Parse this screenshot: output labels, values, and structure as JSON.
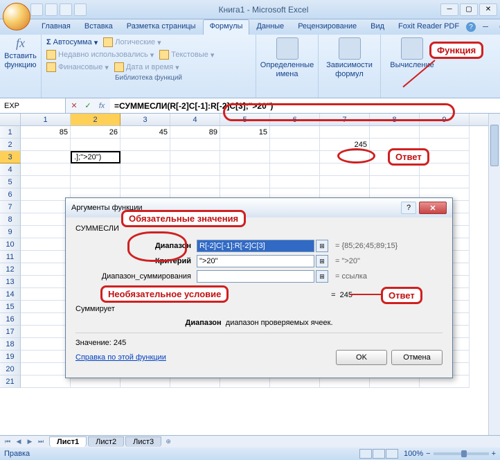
{
  "window": {
    "title": "Книга1 - Microsoft Excel"
  },
  "ribbon": {
    "tabs": [
      "Главная",
      "Вставка",
      "Разметка страницы",
      "Формулы",
      "Данные",
      "Рецензирование",
      "Вид",
      "Foxit Reader PDF"
    ],
    "active_tab": "Формулы",
    "help_icon": "?",
    "insert_fn": {
      "label": "Вставить\nфункцию"
    },
    "library": {
      "autosum": "Автосумма",
      "recent": "Недавно использовались",
      "financial": "Финансовые",
      "logical": "Логические",
      "text": "Текстовые",
      "datetime": "Дата и время",
      "group_label": "Библиотека функций"
    },
    "names": {
      "label": "Определенные\nимена"
    },
    "deps": {
      "label": "Зависимости\nформул"
    },
    "calc": {
      "label": "Вычисление"
    }
  },
  "formula_bar": {
    "name_box": "EXP",
    "formula": "=СУММЕСЛИ(R[-2]C[-1]:R[-2]C[3];\">20\")"
  },
  "columns": [
    "1",
    "2",
    "3",
    "4",
    "5",
    "6",
    "7",
    "8",
    "9"
  ],
  "rows": [
    {
      "n": "1",
      "cells": [
        "85",
        "26",
        "45",
        "89",
        "15",
        "",
        "",
        "",
        ""
      ]
    },
    {
      "n": "2",
      "cells": [
        "",
        "",
        "",
        "",
        "",
        "",
        "245",
        "",
        ""
      ]
    },
    {
      "n": "3",
      "cells": [
        "",
        ".];\">20\")",
        "",
        "",
        "",
        "",
        "",
        "",
        ""
      ]
    },
    {
      "n": "4",
      "cells": [
        "",
        "",
        "",
        "",
        "",
        "",
        "",
        "",
        ""
      ]
    },
    {
      "n": "5",
      "cells": [
        "",
        "",
        "",
        "",
        "",
        "",
        "",
        "",
        ""
      ]
    },
    {
      "n": "6",
      "cells": [
        "",
        "",
        "",
        "",
        "",
        "",
        "",
        "",
        ""
      ]
    },
    {
      "n": "7",
      "cells": [
        "",
        "",
        "",
        "",
        "",
        "",
        "",
        "",
        ""
      ]
    },
    {
      "n": "8",
      "cells": [
        "",
        "",
        "",
        "",
        "",
        "",
        "",
        "",
        ""
      ]
    },
    {
      "n": "9",
      "cells": [
        "",
        "",
        "",
        "",
        "",
        "",
        "",
        "",
        ""
      ]
    },
    {
      "n": "10",
      "cells": [
        "",
        "",
        "",
        "",
        "",
        "",
        "",
        "",
        ""
      ]
    },
    {
      "n": "11",
      "cells": [
        "",
        "",
        "",
        "",
        "",
        "",
        "",
        "",
        ""
      ]
    },
    {
      "n": "12",
      "cells": [
        "",
        "",
        "",
        "",
        "",
        "",
        "",
        "",
        ""
      ]
    },
    {
      "n": "13",
      "cells": [
        "",
        "",
        "",
        "",
        "",
        "",
        "",
        "",
        ""
      ]
    },
    {
      "n": "14",
      "cells": [
        "",
        "",
        "",
        "",
        "",
        "",
        "",
        "",
        ""
      ]
    },
    {
      "n": "15",
      "cells": [
        "",
        "",
        "",
        "",
        "",
        "",
        "",
        "",
        ""
      ]
    },
    {
      "n": "16",
      "cells": [
        "",
        "",
        "",
        "",
        "",
        "",
        "",
        "",
        ""
      ]
    },
    {
      "n": "17",
      "cells": [
        "",
        "",
        "",
        "",
        "",
        "",
        "",
        "",
        ""
      ]
    },
    {
      "n": "18",
      "cells": [
        "",
        "",
        "",
        "",
        "",
        "",
        "",
        "",
        ""
      ]
    },
    {
      "n": "19",
      "cells": [
        "",
        "",
        "",
        "",
        "",
        "",
        "",
        "",
        ""
      ]
    },
    {
      "n": "20",
      "cells": [
        "",
        "",
        "",
        "",
        "",
        "",
        "",
        "",
        ""
      ]
    },
    {
      "n": "21",
      "cells": [
        "",
        "",
        "",
        "",
        "",
        "",
        "",
        "",
        ""
      ]
    }
  ],
  "active_cell": {
    "row": 3,
    "col": 2
  },
  "sheets": {
    "tabs": [
      "Лист1",
      "Лист2",
      "Лист3"
    ],
    "active": "Лист1"
  },
  "status": {
    "mode": "Правка",
    "zoom": "100%"
  },
  "dialog": {
    "title": "Аргументы функции",
    "fn": "СУММЕСЛИ",
    "args": [
      {
        "label": "Диапазон",
        "value": "R[-2]C[-1]:R[-2]C[3]",
        "result": "= {85;26;45;89;15}",
        "bold": true,
        "selected": true
      },
      {
        "label": "Критерий",
        "value": "\">20\"",
        "result": "= \">20\"",
        "bold": true,
        "selected": false
      },
      {
        "label": "Диапазон_суммирования",
        "value": "",
        "result": "= ссылка",
        "bold": false,
        "selected": false
      }
    ],
    "calc_label": "=",
    "calc_value": "245",
    "summary": "Суммирует",
    "desc_bold": "Диапазон",
    "desc_text": "диапазон проверяемых ячеек.",
    "value_label": "Значение:",
    "value": "245",
    "help_link": "Справка по этой функции",
    "ok": "OK",
    "cancel": "Отмена"
  },
  "annotations": {
    "fn": "Функция",
    "ans": "Ответ",
    "req": "Обязательные значения",
    "opt": "Необязательное условие"
  }
}
